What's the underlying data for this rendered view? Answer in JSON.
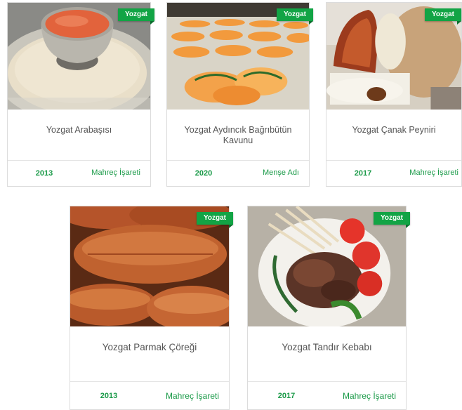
{
  "products": [
    {
      "region": "Yozgat",
      "title": "Yozgat Arabaşısı",
      "year": "2013",
      "type": "Mahreç İşareti"
    },
    {
      "region": "Yozgat",
      "title": "Yozgat Aydıncık Bağrıbütün Kavunu",
      "year": "2020",
      "type": "Menşe Adı"
    },
    {
      "region": "Yozgat",
      "title": "Yozgat Çanak Peyniri",
      "year": "2017",
      "type": "Mahreç İşareti"
    },
    {
      "region": "Yozgat",
      "title": "Yozgat Parmak Çöreği",
      "year": "2013",
      "type": "Mahreç İşareti"
    },
    {
      "region": "Yozgat",
      "title": "Yozgat Tandır Kebabı",
      "year": "2017",
      "type": "Mahreç İşareti"
    }
  ]
}
